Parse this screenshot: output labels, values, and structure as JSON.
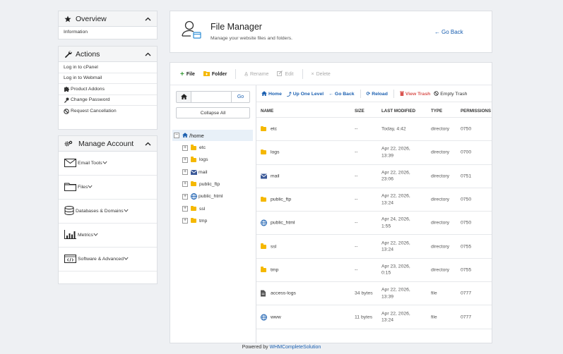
{
  "sidebar": {
    "overview": {
      "title": "Overview",
      "links": [
        "Information"
      ]
    },
    "actions": {
      "title": "Actions",
      "links": [
        {
          "label": "Log in to cPanel",
          "icon": ""
        },
        {
          "label": "Log in to Webmail",
          "icon": ""
        },
        {
          "label": "Product Addons",
          "icon": "puzzle-icon"
        },
        {
          "label": "Change Password",
          "icon": "key-icon"
        },
        {
          "label": "Request Cancellation",
          "icon": "ban-icon"
        }
      ]
    },
    "manage": {
      "title": "Manage Account",
      "items": [
        {
          "label": "Email Tools",
          "icon": "envelope-icon"
        },
        {
          "label": "Files",
          "icon": "folder-icon"
        },
        {
          "label": "Databases & Domains",
          "icon": "database-icon"
        },
        {
          "label": "Metrics",
          "icon": "chart-icon"
        },
        {
          "label": "Software & Advanced",
          "icon": "code-icon"
        }
      ]
    }
  },
  "header": {
    "title": "File Manager",
    "subtitle": "Manage your website files and folders.",
    "back_label": "Go Back"
  },
  "toolbar": {
    "file": "File",
    "folder": "Folder",
    "rename": "Rename",
    "edit": "Edit",
    "delete": "Delete"
  },
  "tree": {
    "go_label": "Go",
    "collapse_label": "Collapse All",
    "root": "/home",
    "children": [
      {
        "label": "etc",
        "icon": "folder-icon"
      },
      {
        "label": "logs",
        "icon": "folder-icon"
      },
      {
        "label": "mail",
        "icon": "envelope-icon"
      },
      {
        "label": "public_ftp",
        "icon": "folder-icon"
      },
      {
        "label": "public_html",
        "icon": "globe-icon"
      },
      {
        "label": "ssl",
        "icon": "folder-icon"
      },
      {
        "label": "tmp",
        "icon": "folder-icon"
      }
    ]
  },
  "nav": {
    "home": "Home",
    "up": "Up One Level",
    "back": "Go Back",
    "reload": "Reload",
    "view_trash": "View Trash",
    "empty_trash": "Empty Trash"
  },
  "table": {
    "headers": [
      "NAME",
      "SIZE",
      "LAST MODIFIED",
      "TYPE",
      "PERMISSIONS"
    ],
    "rows": [
      {
        "icon": "folder-icon",
        "name": "etc",
        "size": "--",
        "modified": "Today, 4:42",
        "type": "directory",
        "perms": "0750"
      },
      {
        "icon": "folder-icon",
        "name": "logs",
        "size": "--",
        "modified": "Apr 22, 2026, 13:39",
        "type": "directory",
        "perms": "0700"
      },
      {
        "icon": "envelope-icon",
        "name": "mail",
        "size": "--",
        "modified": "Apr 22, 2026, 23:06",
        "type": "directory",
        "perms": "0751"
      },
      {
        "icon": "folder-icon",
        "name": "public_ftp",
        "size": "--",
        "modified": "Apr 22, 2026, 13:24",
        "type": "directory",
        "perms": "0750"
      },
      {
        "icon": "globe-icon",
        "name": "public_html",
        "size": "--",
        "modified": "Apr 24, 2026, 1:55",
        "type": "directory",
        "perms": "0750"
      },
      {
        "icon": "folder-icon",
        "name": "ssl",
        "size": "--",
        "modified": "Apr 22, 2026, 13:24",
        "type": "directory",
        "perms": "0755"
      },
      {
        "icon": "folder-icon",
        "name": "tmp",
        "size": "--",
        "modified": "Apr 23, 2026, 0:15",
        "type": "directory",
        "perms": "0755"
      },
      {
        "icon": "file-icon",
        "name": "access-logs",
        "size": "34 bytes",
        "modified": "Apr 22, 2026, 13:39",
        "type": "file",
        "perms": "0777"
      },
      {
        "icon": "globe-icon",
        "name": "www",
        "size": "11 bytes",
        "modified": "Apr 22, 2026, 13:24",
        "type": "file",
        "perms": "0777"
      }
    ]
  },
  "footer": {
    "prefix": "Powered by",
    "link": "WHMCompleteSolution"
  },
  "colors": {
    "accent": "#1a5fb0",
    "folder": "#f5b800",
    "danger": "#d9534f",
    "success": "#3a9b3a"
  }
}
